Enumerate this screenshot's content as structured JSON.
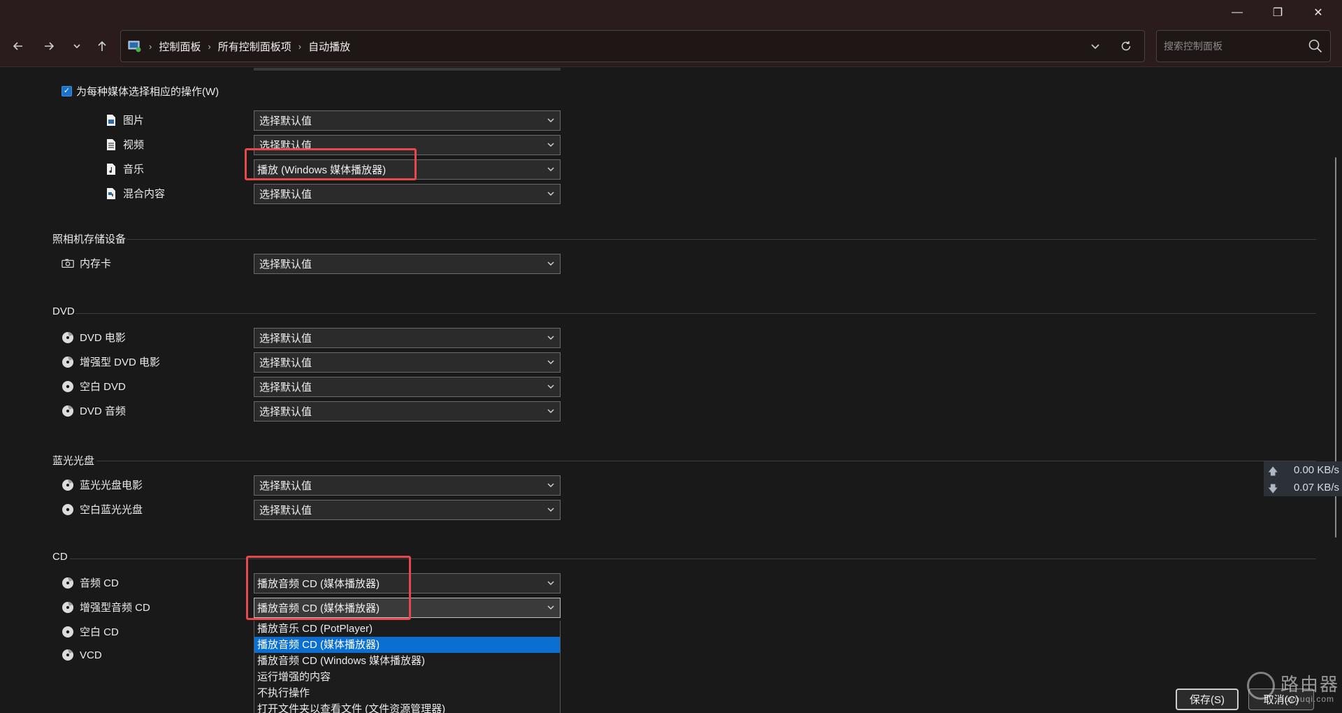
{
  "window": {
    "minimize_glyph": "—",
    "restore_glyph": "❐",
    "close_glyph": "✕"
  },
  "address": {
    "crumbs": [
      "控制面板",
      "所有控制面板项",
      "自动播放"
    ],
    "search_placeholder": "搜索控制面板"
  },
  "media": {
    "checkbox_label": "为每种媒体选择相应的操作(W)",
    "checked": true,
    "items": [
      {
        "label": "图片",
        "icon": "picture-file-icon",
        "value": "选择默认值"
      },
      {
        "label": "视频",
        "icon": "video-file-icon",
        "value": "选择默认值"
      },
      {
        "label": "音乐",
        "icon": "music-file-icon",
        "value": "播放 (Windows 媒体播放器)"
      },
      {
        "label": "混合内容",
        "icon": "mixed-file-icon",
        "value": "选择默认值"
      }
    ]
  },
  "camera": {
    "title": "照相机存储设备",
    "items": [
      {
        "label": "内存卡",
        "icon": "camera-icon",
        "value": "选择默认值"
      }
    ]
  },
  "dvd": {
    "title": "DVD",
    "items": [
      {
        "label": "DVD 电影",
        "icon": "disc-icon",
        "value": "选择默认值"
      },
      {
        "label": "增强型 DVD 电影",
        "icon": "disc-icon",
        "value": "选择默认值"
      },
      {
        "label": "空白 DVD",
        "icon": "blank-disc-icon",
        "value": "选择默认值"
      },
      {
        "label": "DVD 音频",
        "icon": "disc-icon",
        "value": "选择默认值"
      }
    ]
  },
  "bluray": {
    "title": "蓝光光盘",
    "items": [
      {
        "label": "蓝光光盘电影",
        "icon": "disc-icon",
        "value": "选择默认值"
      },
      {
        "label": "空白蓝光光盘",
        "icon": "blank-disc-icon",
        "value": "选择默认值"
      }
    ]
  },
  "cd": {
    "title": "CD",
    "items": [
      {
        "label": "音频 CD",
        "icon": "disc-icon",
        "value": "播放音频 CD (媒体播放器)"
      },
      {
        "label": "增强型音频 CD",
        "icon": "disc-icon",
        "value": "播放音频 CD (媒体播放器)"
      },
      {
        "label": "空白 CD",
        "icon": "blank-disc-icon",
        "value": ""
      },
      {
        "label": "VCD",
        "icon": "disc-icon",
        "value": ""
      }
    ],
    "open_dropdown_options": [
      "播放音乐 CD (PotPlayer)",
      "播放音频 CD (媒体播放器)",
      "播放音频 CD (Windows 媒体播放器)",
      "运行增强的内容",
      "不执行操作",
      "打开文件夹以查看文件 (文件资源管理器)"
    ],
    "open_dropdown_selected_index": 1
  },
  "netspeed": {
    "up": "0.00 KB/s",
    "down": "0.07 KB/s"
  },
  "buttons": {
    "save": "保存(S)",
    "cancel": "取消(C)"
  },
  "watermark": {
    "text": "路由器",
    "sub": "luyouqi.com"
  },
  "colors": {
    "highlight": "#e5484d",
    "accent": "#0a6fd1"
  }
}
